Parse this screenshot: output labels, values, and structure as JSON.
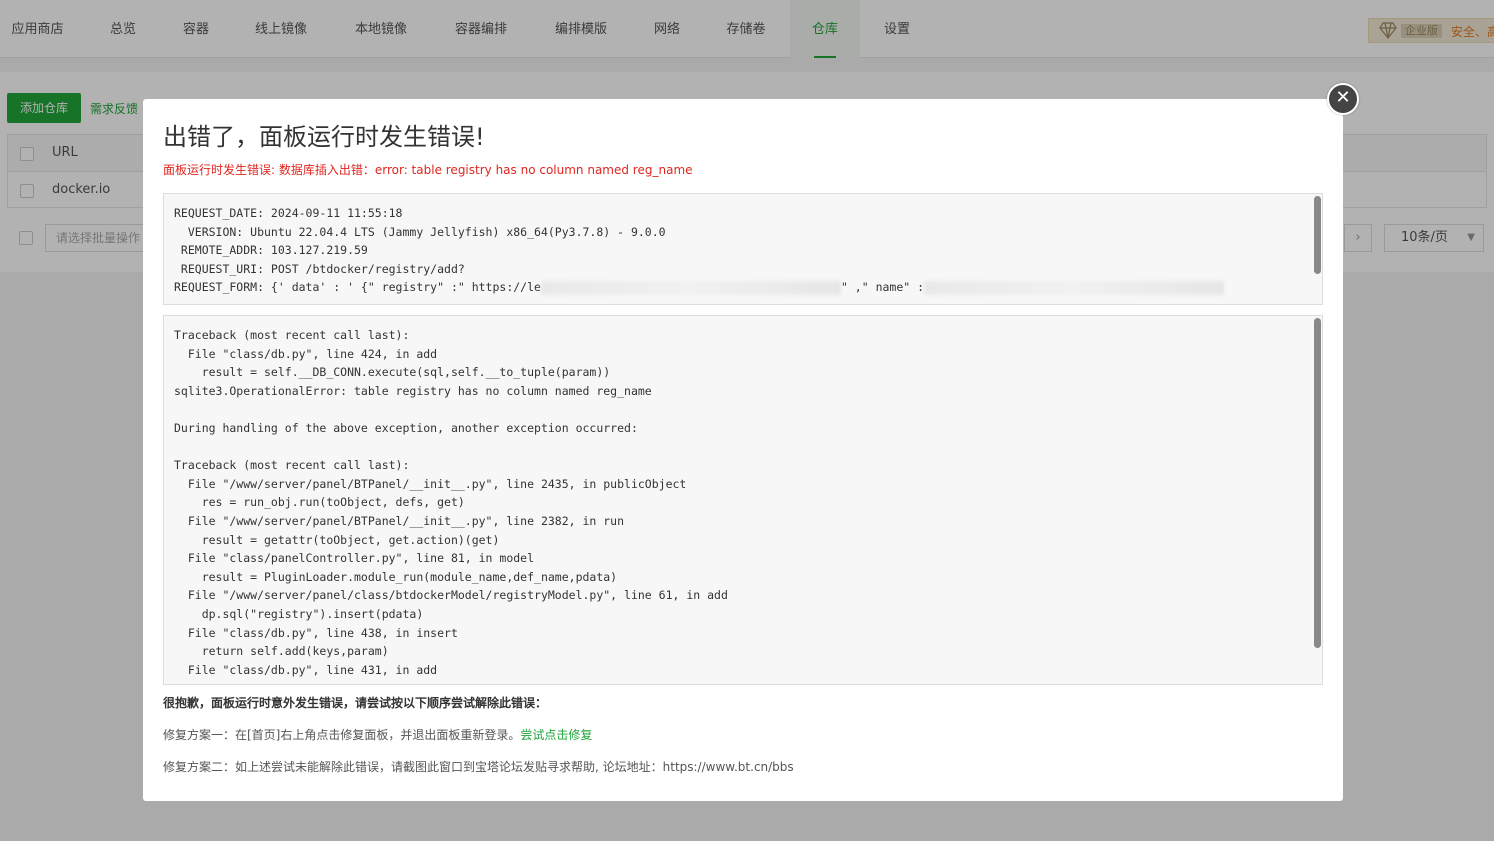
{
  "nav": {
    "tabs": [
      "应用商店",
      "总览",
      "容器",
      "线上镜像",
      "本地镜像",
      "容器编排",
      "编排模版",
      "网络",
      "存储卷",
      "仓库",
      "设置"
    ],
    "active_tab": "仓库",
    "enterprise_label": "企业版",
    "safety_text": "安全、高"
  },
  "page": {
    "add_button": "添加仓库",
    "feedback_link": "需求反馈",
    "table_header_url": "URL",
    "rows": [
      {
        "url": "docker.io"
      }
    ],
    "batch_placeholder": "请选择批量操作",
    "page_next": "›",
    "page_size": "10条/页"
  },
  "modal": {
    "close_symbol": "✕",
    "title": "出错了，面板运行时发生错误!",
    "subtitle": "面板运行时发生错误: 数据库插入出错：error: table registry has no column named reg_name",
    "request_info": {
      "line1": "REQUEST_DATE: 2024-09-11 11:55:18",
      "line2": "  VERSION: Ubuntu 22.04.4 LTS (Jammy Jellyfish) x86_64(Py3.7.8) - 9.0.0",
      "line3": " REMOTE_ADDR: 103.127.219.59",
      "line4": " REQUEST_URI: POST /btdocker/registry/add?",
      "line5_prefix": "REQUEST_FORM: {' data' : ' {\" registry\" :\" https://le",
      "line5_mid": "\" ,\" name\" :"
    },
    "traceback": "Traceback (most recent call last):\n  File \"class/db.py\", line 424, in add\n    result = self.__DB_CONN.execute(sql,self.__to_tuple(param))\nsqlite3.OperationalError: table registry has no column named reg_name\n\nDuring handling of the above exception, another exception occurred:\n\nTraceback (most recent call last):\n  File \"/www/server/panel/BTPanel/__init__.py\", line 2435, in publicObject\n    res = run_obj.run(toObject, defs, get)\n  File \"/www/server/panel/BTPanel/__init__.py\", line 2382, in run\n    result = getattr(toObject, get.action)(get)\n  File \"class/panelController.py\", line 81, in model\n    result = PluginLoader.module_run(module_name,def_name,pdata)\n  File \"/www/server/panel/class/btdockerModel/registryModel.py\", line 61, in add\n    dp.sql(\"registry\").insert(pdata)\n  File \"class/db.py\", line 438, in insert\n    return self.add(keys,param)\n  File \"class/db.py\", line 431, in add",
    "sorry_text": "很抱歉，面板运行时意外发生错误，请尝试按以下顺序尝试解除此错误：",
    "fix1_text": "修复方案一：在[首页]右上角点击修复面板，并退出面板重新登录。",
    "fix1_link": "尝试点击修复",
    "fix2_text": "修复方案二：如上述尝试未能解除此错误，请截图此窗口到宝塔论坛发贴寻求帮助, 论坛地址：https://www.bt.cn/bbs"
  },
  "colors": {
    "brand_green": "#20a53a",
    "error_red": "#e0261f"
  }
}
